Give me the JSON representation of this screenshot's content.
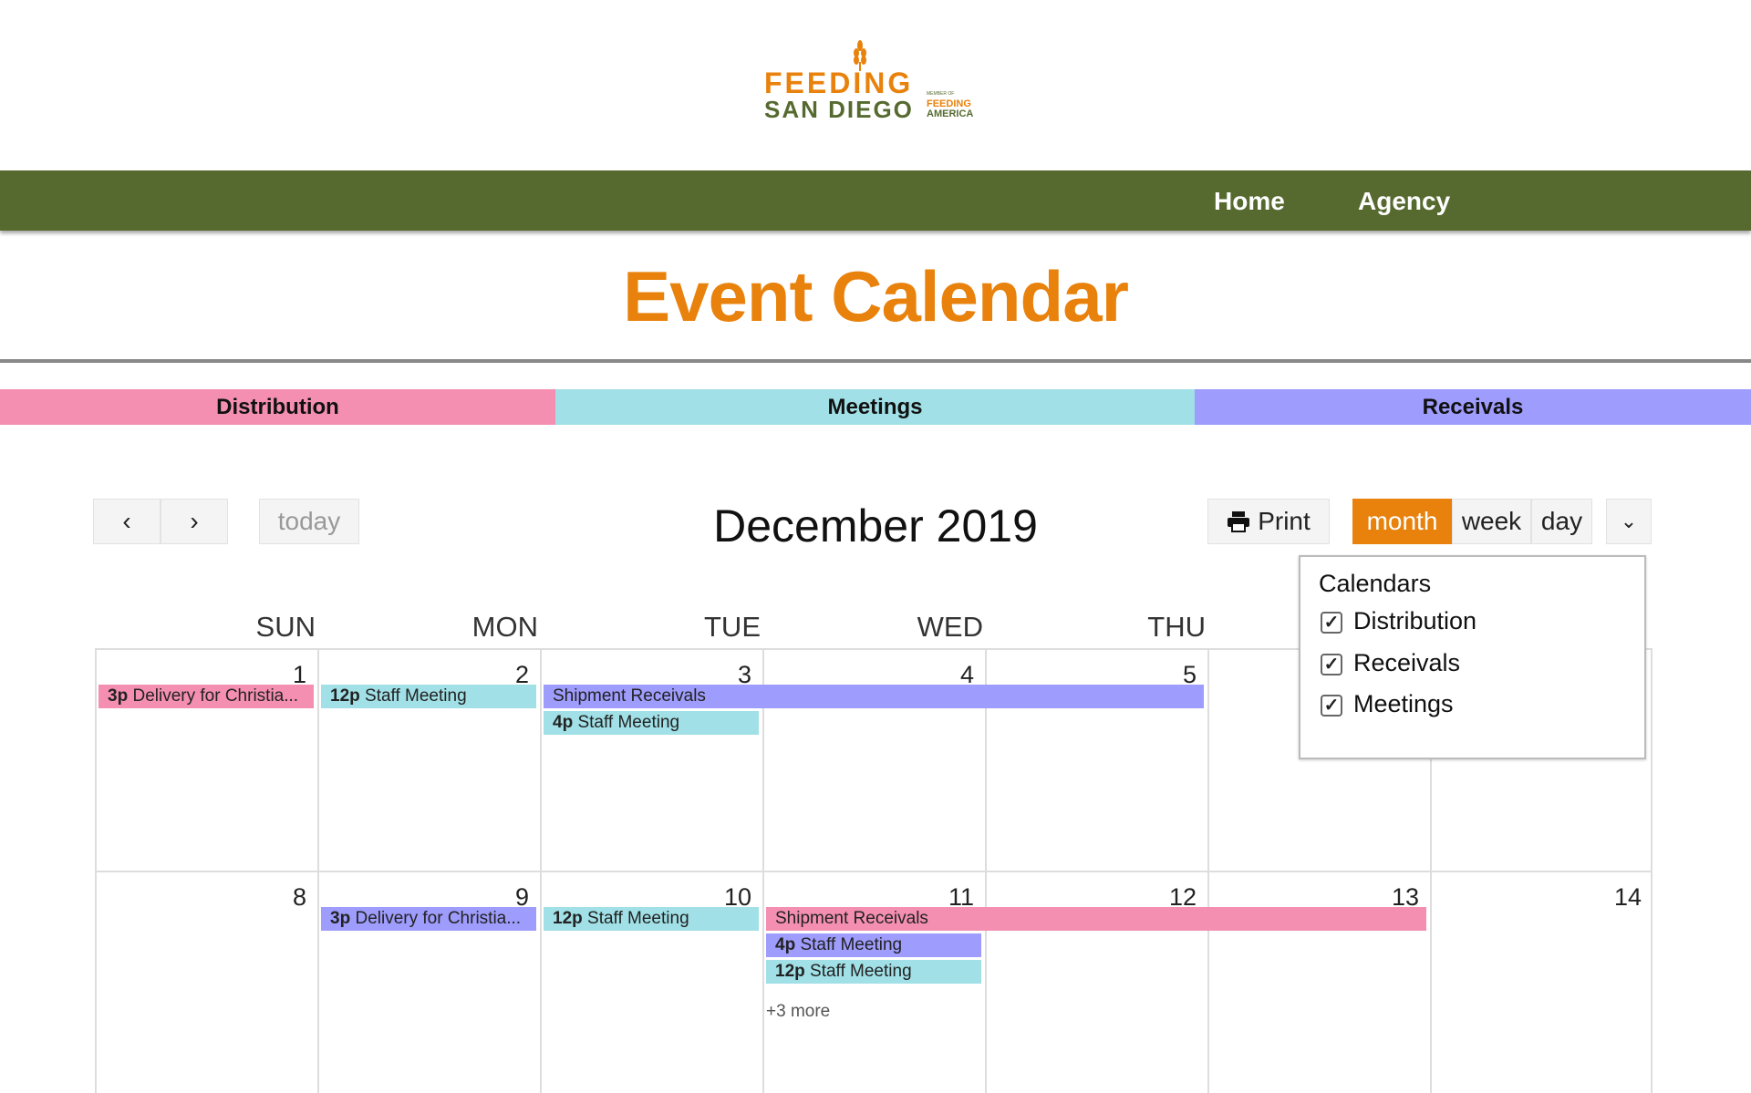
{
  "logo": {
    "line1": "FEEDING",
    "line2": "SAN DIEGO",
    "member": "MEMBER OF",
    "fa1": "FEEDING",
    "fa2": "AMERICA"
  },
  "nav": {
    "items": [
      {
        "label": "Home"
      },
      {
        "label": "Agency"
      }
    ]
  },
  "page_title": "Event Calendar",
  "categories": [
    {
      "label": "Distribution",
      "color": "#f48fb1"
    },
    {
      "label": "Meetings",
      "color": "#a0e0e6"
    },
    {
      "label": "Receivals",
      "color": "#9e9cfc"
    }
  ],
  "toolbar": {
    "prev_icon": "chevron-left-icon",
    "next_icon": "chevron-right-icon",
    "today": "today",
    "title": "December 2019",
    "print": "Print",
    "print_icon": "printer-icon",
    "views": [
      "month",
      "week",
      "day"
    ],
    "active_view": "month",
    "accent": "#e8820c",
    "dropdown_icon": "chevron-down-icon"
  },
  "day_headers": [
    "SUN",
    "MON",
    "TUE",
    "WED",
    "THU"
  ],
  "weeks": [
    {
      "days": [
        "1",
        "2",
        "3",
        "4",
        "5",
        "",
        ""
      ],
      "events": [
        {
          "start": 0,
          "span": 1,
          "lane": 0,
          "time": "3p",
          "title": "Delivery for Christia...",
          "color": "#f48fb1"
        },
        {
          "start": 1,
          "span": 1,
          "lane": 0,
          "time": "12p",
          "title": "Staff Meeting",
          "color": "#a0e0e6"
        },
        {
          "start": 2,
          "span": 3,
          "lane": 0,
          "time": "",
          "title": "Shipment Receivals",
          "color": "#9e9cfc"
        },
        {
          "start": 2,
          "span": 1,
          "lane": 1,
          "time": "4p",
          "title": "Staff Meeting",
          "color": "#a0e0e6"
        }
      ]
    },
    {
      "days": [
        "8",
        "9",
        "10",
        "11",
        "12",
        "13",
        "14"
      ],
      "events": [
        {
          "start": 1,
          "span": 1,
          "lane": 0,
          "time": "3p",
          "title": "Delivery for Christia...",
          "color": "#9e9cfc"
        },
        {
          "start": 2,
          "span": 1,
          "lane": 0,
          "time": "12p",
          "title": "Staff Meeting",
          "color": "#a0e0e6"
        },
        {
          "start": 3,
          "span": 3,
          "lane": 0,
          "time": "",
          "title": "Shipment Receivals",
          "color": "#f48fb1"
        },
        {
          "start": 3,
          "span": 1,
          "lane": 1,
          "time": "4p",
          "title": "Staff Meeting",
          "color": "#9e9cfc"
        },
        {
          "start": 3,
          "span": 1,
          "lane": 2,
          "time": "12p",
          "title": "Staff Meeting",
          "color": "#a0e0e6"
        }
      ],
      "more": {
        "day": 3,
        "label": "+3 more"
      }
    }
  ],
  "calendars_popover": {
    "title": "Calendars",
    "items": [
      {
        "label": "Distribution",
        "checked": true
      },
      {
        "label": "Receivals",
        "checked": true
      },
      {
        "label": "Meetings",
        "checked": true
      }
    ]
  }
}
